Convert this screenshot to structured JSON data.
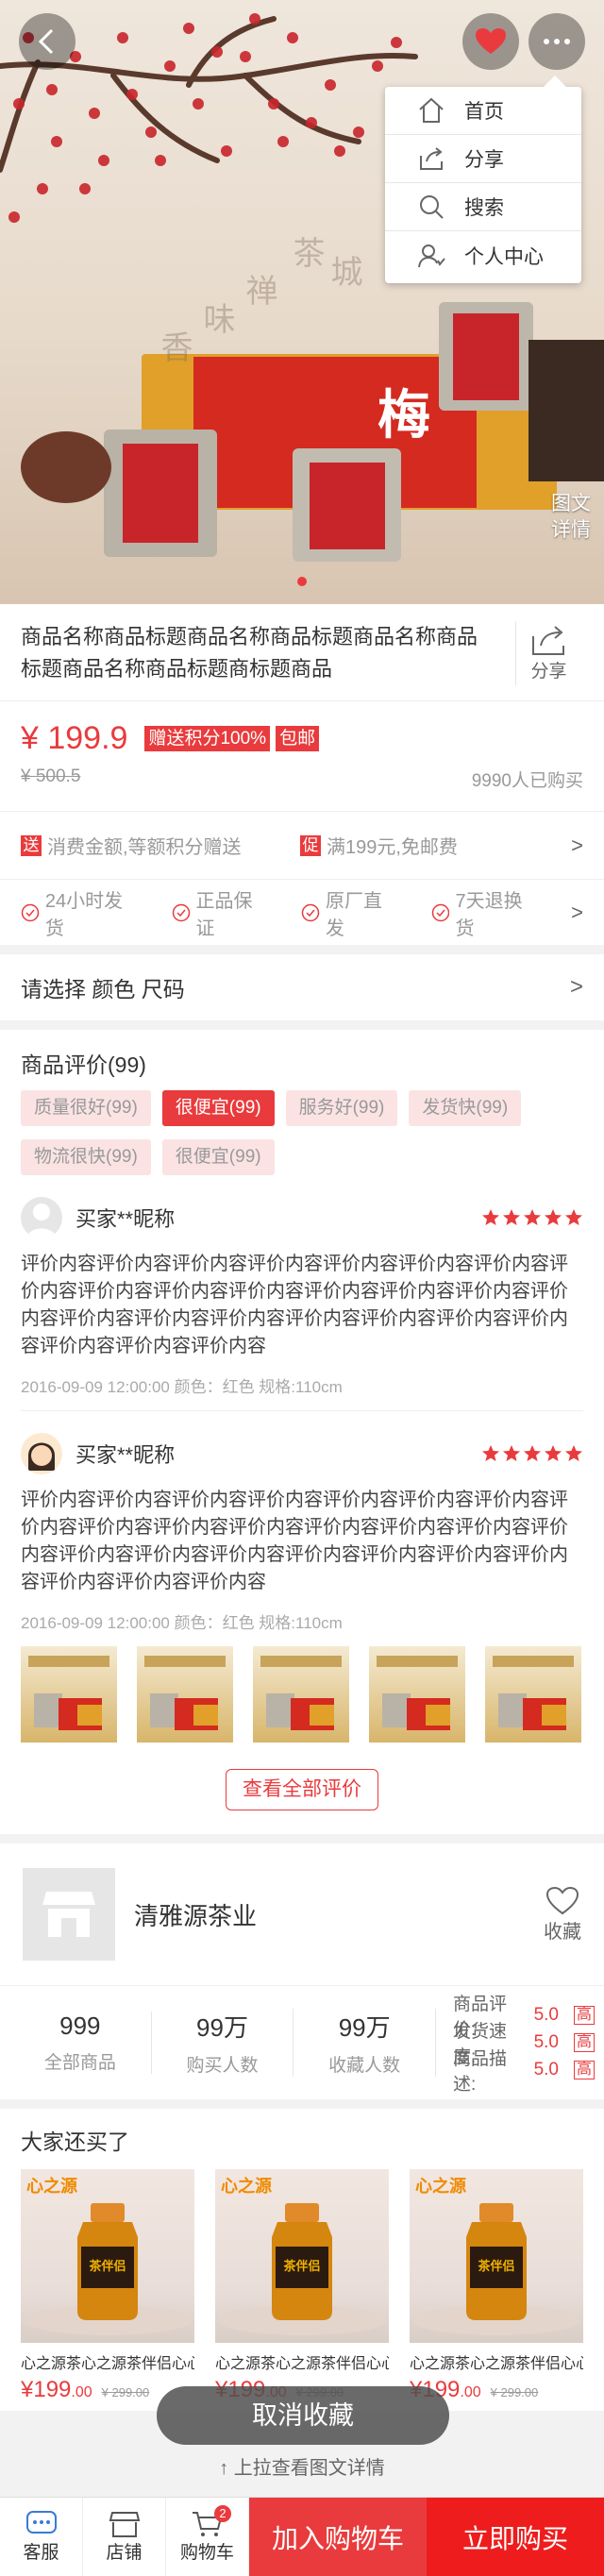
{
  "hero": {
    "calligraphy": [
      "茶",
      "禅",
      "味",
      "香",
      "城"
    ],
    "box_label": "梅",
    "detail_label": "图文\n详情",
    "slide_count": 1
  },
  "menu": {
    "items": [
      {
        "label": "首页",
        "icon": "home-icon"
      },
      {
        "label": "分享",
        "icon": "share-icon"
      },
      {
        "label": "搜索",
        "icon": "search-icon"
      },
      {
        "label": "个人中心",
        "icon": "user-icon"
      }
    ]
  },
  "product": {
    "title": "商品名称商品标题商品名称商品标题商品名称商品标题商品名称商品标题商标题商品",
    "share_label": "分享",
    "price": "¥ 199.9",
    "tags": [
      "赠送积分100%",
      "包邮"
    ],
    "old_price": "¥ 500.5",
    "sold": "9990人已购买"
  },
  "promos": [
    {
      "badge": "送",
      "text": "消费金额,等额积分赠送"
    },
    {
      "badge": "促",
      "text": "满199元,免邮费"
    }
  ],
  "promo_arrow": ">",
  "guarantees": [
    "24小时发货",
    "正品保证",
    "原厂直发",
    "7天退换货"
  ],
  "spec": {
    "label": "请选择 颜色 尺码",
    "arrow": ">"
  },
  "reviews": {
    "header": "商品评价(99)",
    "chips": [
      {
        "label": "质量很好(99)",
        "active": false
      },
      {
        "label": "很便宜(99)",
        "active": true
      },
      {
        "label": "服务好(99)",
        "active": false
      },
      {
        "label": "发货快(99)",
        "active": false
      },
      {
        "label": "物流很快(99)",
        "active": false
      },
      {
        "label": "很便宜(99)",
        "active": false
      }
    ],
    "items": [
      {
        "name": "买家**昵称",
        "stars": 5,
        "text": "评价内容评价内容评价内容评价内容评价内容评价内容评价内容评价内容评价内容评价内容评价内容评价内容评价内容评价内容评价内容评价内容评价内容评价内容评价内容评价内容评价内容评价内容评价内容评价内容评价内容",
        "meta": "2016-09-09  12:00:00 颜色：红色    规格:110cm"
      },
      {
        "name": "买家**昵称",
        "stars": 5,
        "text": "评价内容评价内容评价内容评价内容评价内容评价内容评价内容评价内容评价内容评价内容评价内容评价内容评价内容评价内容评价内容评价内容评价内容评价内容评价内容评价内容评价内容评价内容评价内容评价内容评价内容",
        "meta": "2016-09-09  12:00:00 颜色：红色    规格:110cm"
      }
    ],
    "more_label": "查看全部评价"
  },
  "shop": {
    "name": "清雅源茶业",
    "fav_label": "收藏",
    "stats": [
      {
        "num": "999",
        "label": "全部商品"
      },
      {
        "num": "99万",
        "label": "购买人数"
      },
      {
        "num": "99万",
        "label": "收藏人数"
      }
    ],
    "ratings": [
      {
        "label": "商品评价:",
        "value": "5.0",
        "level": "高"
      },
      {
        "label": "发货速度:",
        "value": "5.0",
        "level": "高"
      },
      {
        "label": "商品描述:",
        "value": "5.0",
        "level": "高"
      }
    ]
  },
  "also": {
    "header": "大家还买了",
    "brand": "心之源",
    "jar_label": "茶伴侣",
    "items": [
      {
        "name": "心之源茶心之源茶伴侣心心...",
        "price": "¥199",
        "cents": ".00",
        "old": "¥ 299.00"
      },
      {
        "name": "心之源茶心之源茶伴侣心心...",
        "price": "¥199",
        "cents": ".00",
        "old": "¥ 299.00"
      },
      {
        "name": "心之源茶心之源茶伴侣心心...",
        "price": "¥199",
        "cents": ".00",
        "old": "¥ 299.00"
      }
    ]
  },
  "toast": "取消收藏",
  "pull_hint": "↑ 上拉查看图文详情",
  "bottom_bar": {
    "service": "客服",
    "store": "店铺",
    "cart": "购物车",
    "cart_count": "2",
    "add_cart": "加入购物车",
    "buy_now": "立即购买"
  },
  "colors": {
    "accent": "#e93b3d",
    "chip_bg": "#fbe3e3"
  }
}
